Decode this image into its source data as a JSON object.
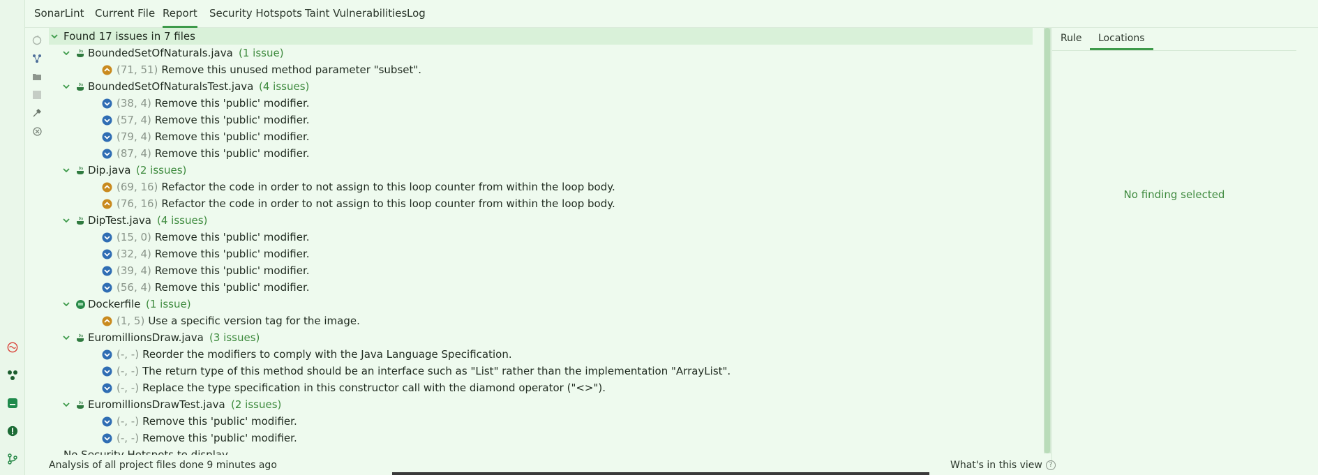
{
  "tabs": [
    {
      "label": "SonarLint"
    },
    {
      "label": "Current File"
    },
    {
      "label": "Report"
    },
    {
      "label": "Security Hotspots"
    },
    {
      "label": "Taint Vulnerabilities"
    },
    {
      "label": "Log"
    }
  ],
  "active_tab": "Report",
  "summary": "Found 17 issues in 7 files",
  "files": [
    {
      "name": "BoundedSetOfNaturals.java",
      "count": "(1 issue)",
      "icon": "java-icon",
      "issues": [
        {
          "severity": "major",
          "loc": "(71, 51)",
          "text": "Remove this unused method parameter \"subset\"."
        }
      ]
    },
    {
      "name": "BoundedSetOfNaturalsTest.java",
      "count": "(4 issues)",
      "icon": "java-icon",
      "issues": [
        {
          "severity": "minor",
          "loc": "(38, 4)",
          "text": "Remove this 'public' modifier."
        },
        {
          "severity": "minor",
          "loc": "(57, 4)",
          "text": "Remove this 'public' modifier."
        },
        {
          "severity": "minor",
          "loc": "(79, 4)",
          "text": "Remove this 'public' modifier."
        },
        {
          "severity": "minor",
          "loc": "(87, 4)",
          "text": "Remove this 'public' modifier."
        }
      ]
    },
    {
      "name": "Dip.java",
      "count": "(2 issues)",
      "icon": "java-icon",
      "issues": [
        {
          "severity": "major",
          "loc": "(69, 16)",
          "text": "Refactor the code in order to not assign to this loop counter from within the loop body."
        },
        {
          "severity": "major",
          "loc": "(76, 16)",
          "text": "Refactor the code in order to not assign to this loop counter from within the loop body."
        }
      ]
    },
    {
      "name": "DipTest.java",
      "count": "(4 issues)",
      "icon": "java-icon",
      "issues": [
        {
          "severity": "minor",
          "loc": "(15, 0)",
          "text": "Remove this 'public' modifier."
        },
        {
          "severity": "minor",
          "loc": "(32, 4)",
          "text": "Remove this 'public' modifier."
        },
        {
          "severity": "minor",
          "loc": "(39, 4)",
          "text": "Remove this 'public' modifier."
        },
        {
          "severity": "minor",
          "loc": "(56, 4)",
          "text": "Remove this 'public' modifier."
        }
      ]
    },
    {
      "name": "Dockerfile",
      "count": "(1 issue)",
      "icon": "docker-icon",
      "issues": [
        {
          "severity": "major",
          "loc": "(1, 5)",
          "text": "Use a specific version tag for the image."
        }
      ]
    },
    {
      "name": "EuromillionsDraw.java",
      "count": "(3 issues)",
      "icon": "java-icon",
      "issues": [
        {
          "severity": "minor",
          "loc": "(-, -)",
          "text": "Reorder the modifiers to comply with the Java Language Specification."
        },
        {
          "severity": "minor",
          "loc": "(-, -)",
          "text": "The return type of this method should be an interface such as \"List\" rather than the implementation \"ArrayList\"."
        },
        {
          "severity": "minor",
          "loc": "(-, -)",
          "text": "Replace the type specification in this constructor call with the diamond operator (\"<>\")."
        }
      ]
    },
    {
      "name": "EuromillionsDrawTest.java",
      "count": "(2 issues)",
      "icon": "java-icon",
      "issues": [
        {
          "severity": "minor",
          "loc": "(-, -)",
          "text": "Remove this 'public' modifier."
        },
        {
          "severity": "minor",
          "loc": "(-, -)",
          "text": "Remove this 'public' modifier."
        }
      ]
    }
  ],
  "hotspots_text": "No Security Hotspots to display",
  "right_panel": {
    "tabs": [
      {
        "label": "Rule"
      },
      {
        "label": "Locations"
      }
    ],
    "active": "Locations",
    "empty_text": "No finding selected"
  },
  "status": {
    "left": "Analysis of all project files done 9 minutes ago",
    "right": "What's in this view",
    "help_glyph": "?"
  },
  "colors": {
    "accent": "#3d9a4a",
    "major": "#c98a1e",
    "minor": "#2f6db3",
    "count": "#3d8a3d"
  }
}
